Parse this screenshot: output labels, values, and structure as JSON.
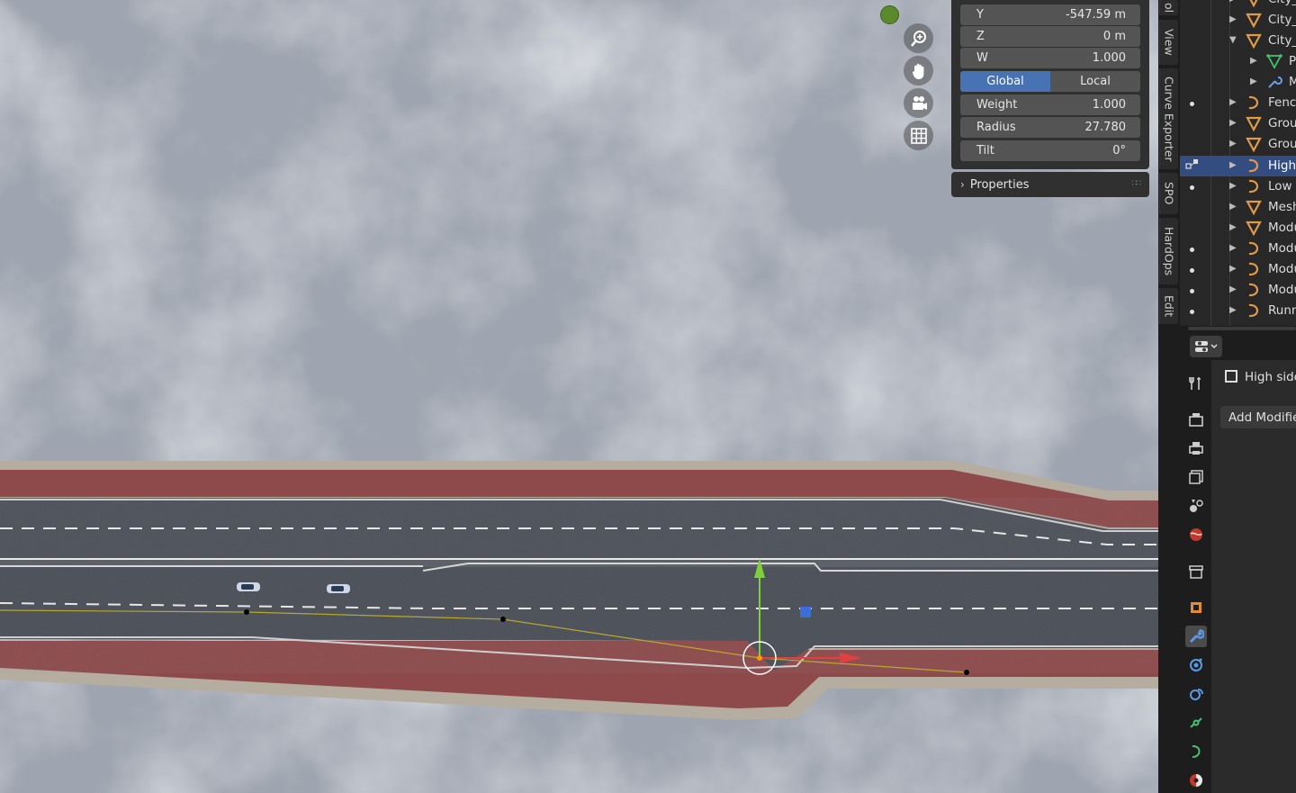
{
  "npanel": {
    "fields": [
      {
        "label": "Y",
        "value": "-547.59 m"
      },
      {
        "label": "Z",
        "value": "0 m"
      },
      {
        "label": "W",
        "value": "1.000"
      }
    ],
    "space_toggle": {
      "options": [
        "Global",
        "Local"
      ],
      "active": "Global"
    },
    "point_fields": [
      {
        "label": "Weight",
        "value": "1.000"
      },
      {
        "label": "Radius",
        "value": "27.780"
      },
      {
        "label": "Tilt",
        "value": "0°"
      }
    ],
    "properties_label": "Properties"
  },
  "sidebar_tabs": [
    "ol",
    "View",
    "Curve Exporter",
    "SPO",
    "HardOps",
    "Edit"
  ],
  "outliner": {
    "rows": [
      {
        "label": "City_",
        "icon": "mesh-icon",
        "indent": 1,
        "expanded": false,
        "dot": false
      },
      {
        "label": "City_",
        "icon": "mesh-icon",
        "indent": 1,
        "expanded": false,
        "dot": false
      },
      {
        "label": "City_",
        "icon": "mesh-icon",
        "indent": 1,
        "expanded": true,
        "dot": false
      },
      {
        "label": "P",
        "icon": "vertex-group-icon",
        "indent": 2,
        "expanded": false,
        "dot": false
      },
      {
        "label": "M",
        "icon": "modifier-wrench-icon",
        "indent": 2,
        "expanded": false,
        "dot": false
      },
      {
        "label": "Fenc",
        "icon": "curve-icon",
        "indent": 1,
        "expanded": false,
        "dot": true
      },
      {
        "label": "Grou",
        "icon": "mesh-icon",
        "indent": 1,
        "expanded": false,
        "dot": false
      },
      {
        "label": "Grou",
        "icon": "mesh-icon",
        "indent": 1,
        "expanded": false,
        "dot": false
      },
      {
        "label": "High",
        "icon": "curve-icon",
        "indent": 1,
        "expanded": false,
        "dot": false,
        "selected": true
      },
      {
        "label": "Low",
        "icon": "curve-icon",
        "indent": 1,
        "expanded": false,
        "dot": true
      },
      {
        "label": "Mesh",
        "icon": "mesh-icon",
        "indent": 1,
        "expanded": false,
        "dot": false
      },
      {
        "label": "Modu",
        "icon": "mesh-icon",
        "indent": 1,
        "expanded": false,
        "dot": false
      },
      {
        "label": "Modu",
        "icon": "curve-icon",
        "indent": 1,
        "expanded": false,
        "dot": true
      },
      {
        "label": "Modu",
        "icon": "curve-icon",
        "indent": 1,
        "expanded": false,
        "dot": true
      },
      {
        "label": "Modu",
        "icon": "curve-icon",
        "indent": 1,
        "expanded": false,
        "dot": true
      },
      {
        "label": "Runn",
        "icon": "curve-icon",
        "indent": 1,
        "expanded": false,
        "dot": true
      }
    ]
  },
  "properties": {
    "object_name": "High side",
    "add_modifier_label": "Add Modifier",
    "tabs": [
      "tool",
      "render",
      "output",
      "view-layer",
      "scene",
      "world",
      "collection",
      "object",
      "modifiers",
      "particles",
      "physics",
      "constraints",
      "data",
      "material"
    ],
    "active_tab": "modifiers"
  },
  "colors": {
    "accent": "#4772b3",
    "selected_row": "#334d80",
    "mesh_orange": "#e09a4a",
    "road_red": "#8e4a4b",
    "asphalt": "#4a4e56",
    "gizmo_green": "#7fd03a",
    "gizmo_red": "#e24040",
    "gizmo_blue": "#3a6fd8"
  }
}
